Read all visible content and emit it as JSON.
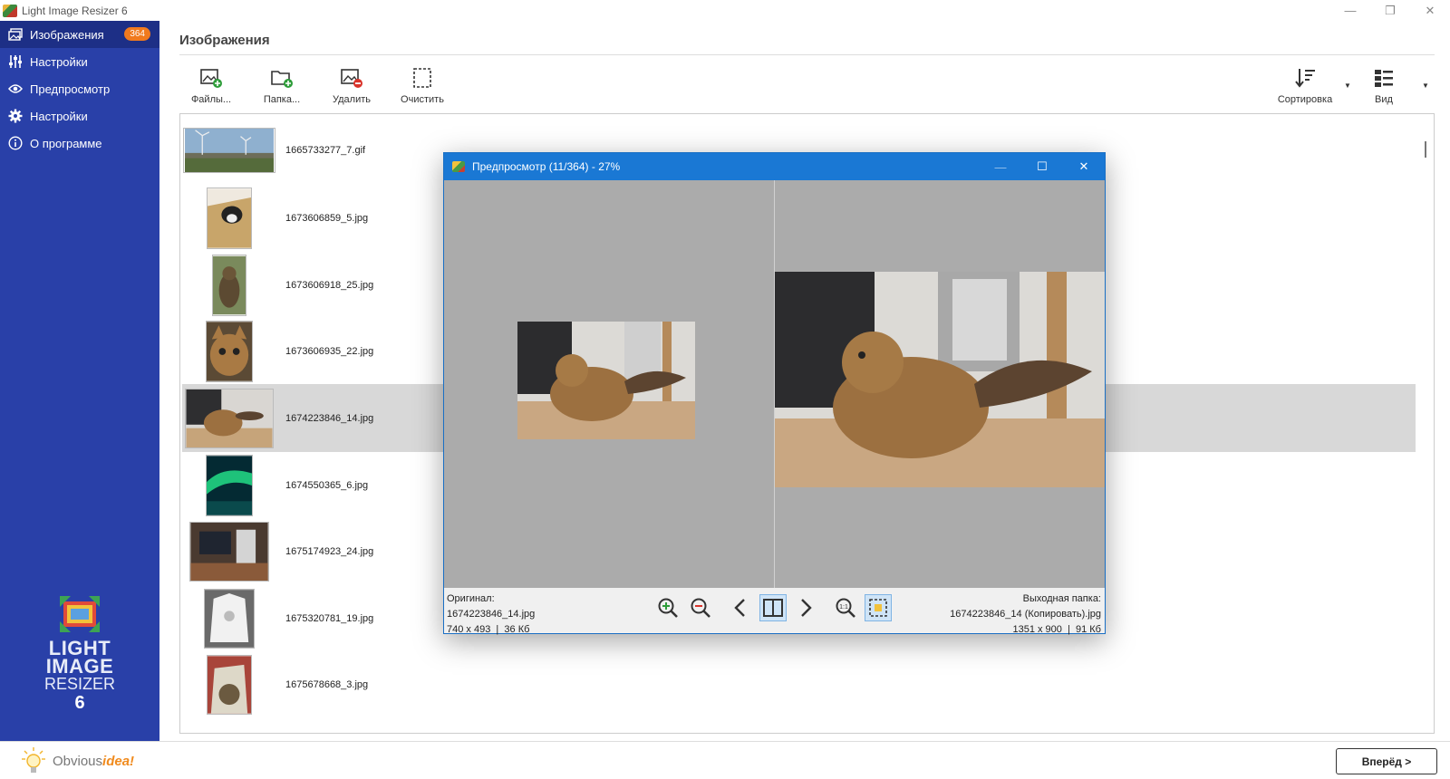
{
  "window": {
    "title": "Light Image Resizer 6",
    "minimize": "—",
    "restore": "❐",
    "close": "✕"
  },
  "sidebar": {
    "items": [
      {
        "label": "Изображения",
        "badge": "364",
        "icon": "images-icon"
      },
      {
        "label": "Настройки",
        "icon": "sliders-icon"
      },
      {
        "label": "Предпросмотр",
        "icon": "eye-icon"
      },
      {
        "label": "Настройки",
        "icon": "gear-icon"
      },
      {
        "label": "О программе",
        "icon": "info-icon"
      }
    ],
    "logo": {
      "line1": "LIGHT",
      "line2": "IMAGE",
      "line3": "RESIZER",
      "line4": "6"
    }
  },
  "main": {
    "title": "Изображения",
    "toolbar": {
      "files": "Файлы...",
      "folder": "Папка...",
      "delete": "Удалить",
      "clear": "Очистить",
      "sort": "Сортировка",
      "view": "Вид"
    },
    "files": [
      {
        "name": "1665733277_7.gif"
      },
      {
        "name": "1673606859_5.jpg"
      },
      {
        "name": "1673606918_25.jpg"
      },
      {
        "name": "1673606935_22.jpg"
      },
      {
        "name": "1674223846_14.jpg",
        "selected": true
      },
      {
        "name": "1674550365_6.jpg"
      },
      {
        "name": "1675174923_24.jpg"
      },
      {
        "name": "1675320781_19.jpg"
      },
      {
        "name": "1675678668_3.jpg"
      }
    ]
  },
  "preview": {
    "title": "Предпросмотр (11/364) - 27%",
    "original_label": "Оригинал:",
    "original_file": "1674223846_14.jpg",
    "original_info": "740 x 493  |  36 Кб",
    "output_label": "Выходная папка:",
    "output_file": "1674223846_14 (Копировать).jpg",
    "output_info": "1351 x 900  |  91 Кб"
  },
  "footer": {
    "brand_a": "Obvious",
    "brand_b": "idea!",
    "next": "Вперёд >"
  },
  "colors": {
    "sidebar": "#2940a8",
    "sidebar_active": "#1d2f86",
    "badge": "#f07a1e",
    "dialog_title": "#1a78d4",
    "selected_row": "#d8d8d8"
  }
}
